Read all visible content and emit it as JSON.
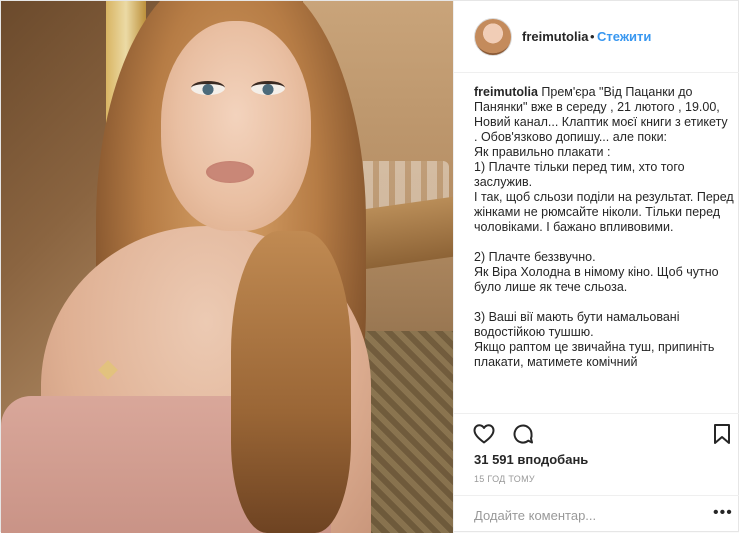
{
  "post": {
    "username": "freimutolia",
    "dot": "•",
    "follow_label": "Стежити",
    "caption_username": "freimutolia",
    "caption_text": "Прем'єра \"Від Пацанки до Панянки\" вже в середу , 21 лютого , 19.00, Новий канал... Клаптик моєї книги з етикету . Обов'язково допишу... але поки:\nЯк правильно плакати :\n1) Плачте тільки перед тим, хто того заслужив.\nІ так, щоб сльози поділи на результат. Перед жінками не рюмсайте ніколи. Тільки перед чоловіками. І бажано впливовими.\n\n2) Плачте беззвучно.\nЯк Віра Холодна в німому кіно. Щоб чутно було лише як тече сльоза.\n\n3) Ваші вії мають бути намальовані водостійкою тушшю.\nЯкщо раптом це звичайна туш, припиніть плакати, матимете комічний",
    "likes": "31 591 вподобань",
    "time": "15 ГОД ТОМУ",
    "comment_placeholder": "Додайте коментар...",
    "more_glyph": "•••"
  },
  "icons": {
    "like": "heart-icon",
    "comment": "comment-icon",
    "save": "bookmark-icon"
  },
  "colors": {
    "link": "#3897f0",
    "text": "#262626",
    "muted": "#999999",
    "border": "#efefef"
  }
}
